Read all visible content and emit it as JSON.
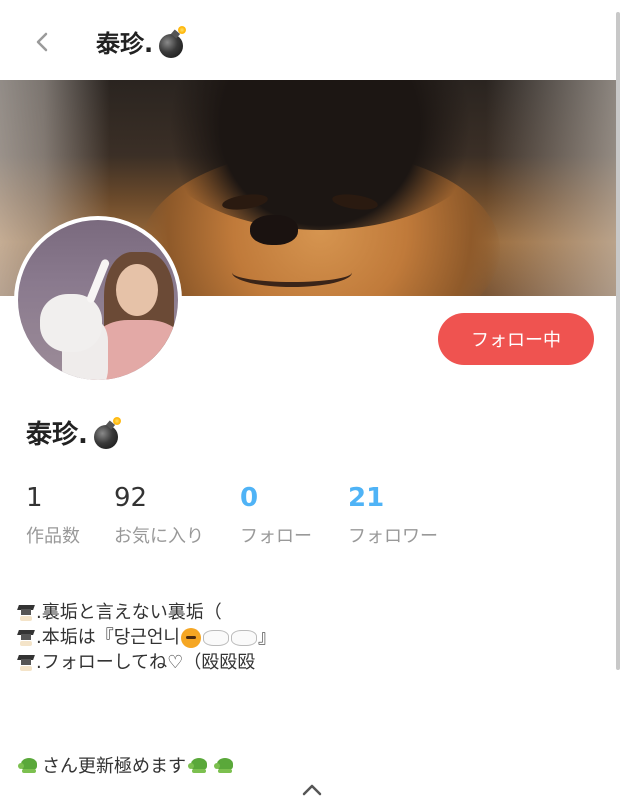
{
  "header": {
    "back_icon": "chevron-left-icon",
    "title": "泰珍."
  },
  "cover": {
    "description_icon": "cover-photo"
  },
  "profile": {
    "follow_button": "フォロー中",
    "follow_color": "#ef5350",
    "name": "泰珍."
  },
  "stats": [
    {
      "value": "1",
      "label": "作品数"
    },
    {
      "value": "92",
      "label": "お気に入り"
    },
    {
      "value": "0",
      "label": "フォロー"
    },
    {
      "value": "21",
      "label": "フォロワー"
    }
  ],
  "accent_color": "#4fb3f6",
  "bio": {
    "line1": ".裏垢と言えない裏垢（",
    "line2a": ".本垢は『당근언니",
    "line2b": "』",
    "line3": ".フォローしてね♡（殴殴殴"
  },
  "footer": {
    "text": "さん更新極めます"
  }
}
